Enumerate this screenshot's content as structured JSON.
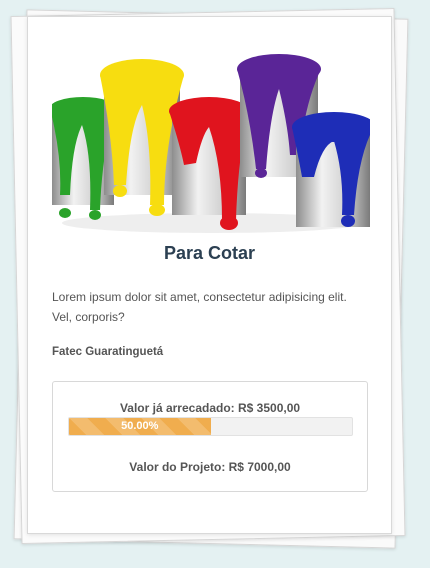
{
  "project": {
    "title": "Para Cotar",
    "description": "Lorem ipsum dolor sit amet, consectetur adipisicing elit. Vel, corporis?",
    "organization": "Fatec Guaratinguetá",
    "raised_text": "Valor já arrecadado: R$ 3500,00",
    "progress_percent": 50,
    "progress_label": "50.00%",
    "goal_text": "Valor do Projeto: R$ 7000,00"
  },
  "colors": {
    "title": "#2c4052",
    "progress": "#f0ad4e",
    "paint_green": "#2aa32a",
    "paint_yellow": "#f7dd10",
    "paint_red": "#e0141e",
    "paint_purple": "#5a2597",
    "paint_blue": "#1e2db7"
  }
}
